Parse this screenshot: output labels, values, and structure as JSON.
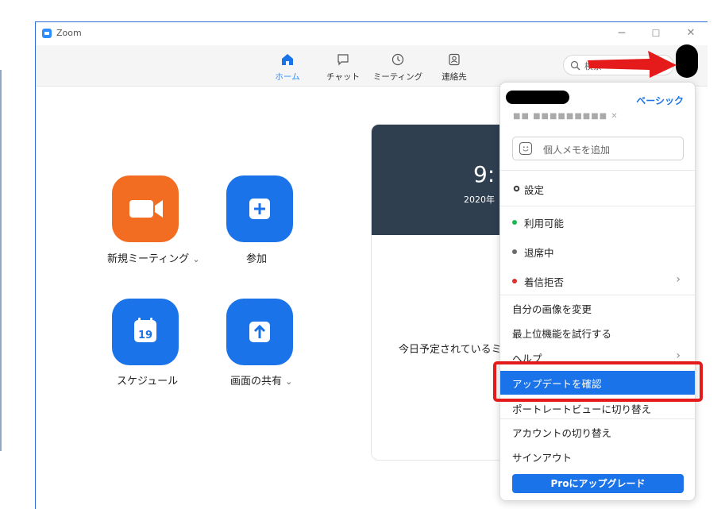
{
  "window": {
    "title": "Zoom",
    "minimize": "─",
    "maximize": "☐",
    "close": "✕"
  },
  "nav": {
    "tabs": [
      {
        "label": "ホーム",
        "icon": "home-icon",
        "active": true
      },
      {
        "label": "チャット",
        "icon": "chat-icon",
        "active": false
      },
      {
        "label": "ミーティング",
        "icon": "clock-icon",
        "active": false
      },
      {
        "label": "連絡先",
        "icon": "contacts-icon",
        "active": false
      }
    ],
    "search_placeholder": "検索"
  },
  "home": {
    "new_meeting": "新規ミーティング",
    "join": "参加",
    "schedule": "スケジュール",
    "schedule_day": "19",
    "share_screen": "画面の共有",
    "chevron": "⌄"
  },
  "card": {
    "time": "9:",
    "date": "2020年",
    "no_meetings": "今日予定されているミ"
  },
  "menu": {
    "plan": "ベーシック",
    "email": "■■ ■■■■■■■■■  ✕",
    "memo_placeholder": "個人メモを追加",
    "settings": "設定",
    "available": "利用可能",
    "away": "退席中",
    "dnd": "着信拒否",
    "change_picture": "自分の画像を変更",
    "try_features": "最上位機能を試行する",
    "help": "ヘルプ",
    "check_updates": "アップデートを確認",
    "portrait_view": "ポートレートビューに切り替え",
    "switch_account": "アカウントの切り替え",
    "sign_out": "サインアウト",
    "upgrade": "Proにアップグレード",
    "chevron": "›"
  },
  "colors": {
    "accent": "#1a73e8",
    "orange": "#f26d21",
    "available": "#1db954",
    "away": "#6b6b6b",
    "dnd": "#e02f2f",
    "highlight": "#e51a1a"
  }
}
